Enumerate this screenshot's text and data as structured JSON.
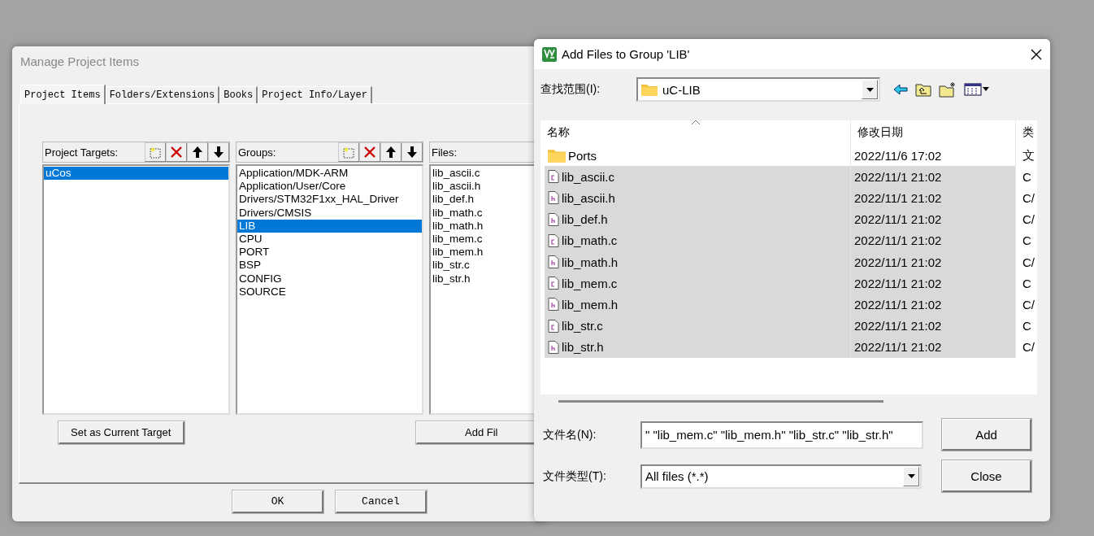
{
  "manage_window": {
    "title": "Manage Project Items",
    "tabs": [
      {
        "label": "Project Items",
        "selected": true
      },
      {
        "label": "Folders/Extensions",
        "selected": false
      },
      {
        "label": "Books",
        "selected": false
      },
      {
        "label": "Project Info/Layer",
        "selected": false
      }
    ],
    "panels": [
      {
        "label": "Project Targets:",
        "tools": true,
        "items": [
          {
            "label": "uCos",
            "selected": true
          }
        ]
      },
      {
        "label": "Groups:",
        "tools": true,
        "items": [
          {
            "label": "Application/MDK-ARM",
            "selected": false
          },
          {
            "label": "Application/User/Core",
            "selected": false
          },
          {
            "label": "Drivers/STM32F1xx_HAL_Driver",
            "selected": false
          },
          {
            "label": "Drivers/CMSIS",
            "selected": false
          },
          {
            "label": "LIB",
            "selected": true
          },
          {
            "label": "CPU",
            "selected": false
          },
          {
            "label": "PORT",
            "selected": false
          },
          {
            "label": "BSP",
            "selected": false
          },
          {
            "label": "CONFIG",
            "selected": false
          },
          {
            "label": "SOURCE",
            "selected": false
          }
        ]
      },
      {
        "label": "Files:",
        "tools": false,
        "items": [
          {
            "label": "lib_ascii.c",
            "selected": false
          },
          {
            "label": "lib_ascii.h",
            "selected": false
          },
          {
            "label": "lib_def.h",
            "selected": false
          },
          {
            "label": "lib_math.c",
            "selected": false
          },
          {
            "label": "lib_math.h",
            "selected": false
          },
          {
            "label": "lib_mem.c",
            "selected": false
          },
          {
            "label": "lib_mem.h",
            "selected": false
          },
          {
            "label": "lib_str.c",
            "selected": false
          },
          {
            "label": "lib_str.h",
            "selected": false
          }
        ]
      }
    ],
    "panel_buttons": [
      "Set as Current Target",
      "Add Fil"
    ],
    "footer_buttons": [
      "OK",
      "Cancel"
    ]
  },
  "add_files_dialog": {
    "title": "Add Files to Group 'LIB'",
    "look_in": {
      "label": "查找范围(I):",
      "value": "uC-LIB"
    },
    "columns": [
      "名称",
      "修改日期",
      "类"
    ],
    "rows": [
      {
        "kind": "folder",
        "name": "Ports",
        "date": "2022/11/6 17:02",
        "type": "文",
        "selected": false
      },
      {
        "kind": "source",
        "name": "lib_ascii.c",
        "date": "2022/11/1 21:02",
        "type": "C",
        "selected": true
      },
      {
        "kind": "header",
        "name": "lib_ascii.h",
        "date": "2022/11/1 21:02",
        "type": "C/",
        "selected": true
      },
      {
        "kind": "header",
        "name": "lib_def.h",
        "date": "2022/11/1 21:02",
        "type": "C/",
        "selected": true
      },
      {
        "kind": "source",
        "name": "lib_math.c",
        "date": "2022/11/1 21:02",
        "type": "C",
        "selected": true
      },
      {
        "kind": "header",
        "name": "lib_math.h",
        "date": "2022/11/1 21:02",
        "type": "C/",
        "selected": true
      },
      {
        "kind": "source",
        "name": "lib_mem.c",
        "date": "2022/11/1 21:02",
        "type": "C",
        "selected": true
      },
      {
        "kind": "header",
        "name": "lib_mem.h",
        "date": "2022/11/1 21:02",
        "type": "C/",
        "selected": true
      },
      {
        "kind": "source",
        "name": "lib_str.c",
        "date": "2022/11/1 21:02",
        "type": "C",
        "selected": true
      },
      {
        "kind": "header",
        "name": "lib_str.h",
        "date": "2022/11/1 21:02",
        "type": "C/",
        "selected": true
      }
    ],
    "file_name": {
      "label": "文件名(N):",
      "value": "\" \"lib_mem.c\" \"lib_mem.h\" \"lib_str.c\" \"lib_str.h\""
    },
    "file_type": {
      "label": "文件类型(T):",
      "value": "All files (*.*)"
    },
    "buttons": [
      "Add",
      "Close"
    ]
  }
}
